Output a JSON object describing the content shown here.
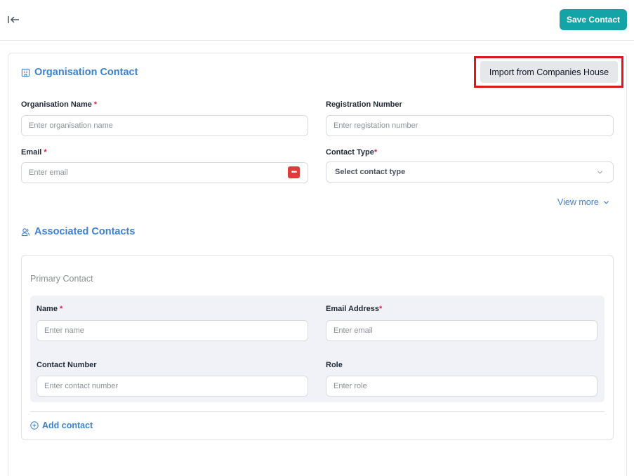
{
  "toolbar": {
    "collapse_icon": "collapse-left-icon",
    "save_label": "Save Contact",
    "accent_color": "#14a3a6"
  },
  "organisation": {
    "title": "Organisation Contact",
    "icon": "building-icon",
    "import_label": "Import from Companies House",
    "fields": {
      "org_name": {
        "label": "Organisation Name",
        "required": "*",
        "placeholder": "Enter organisation name"
      },
      "reg_number": {
        "label": "Registration Number",
        "placeholder": "Enter registation number"
      },
      "email": {
        "label": "Email",
        "required": "*",
        "placeholder": "Enter email",
        "trailing_icon": "password-manager-icon"
      },
      "contact_type": {
        "label": "Contact Type",
        "required": "*",
        "placeholder": "Select contact type"
      }
    },
    "view_more": "View more"
  },
  "associated": {
    "title": "Associated Contacts",
    "icon": "user-group-icon",
    "primary_label": "Primary Contact",
    "fields": {
      "name": {
        "label": "Name",
        "required": "*",
        "placeholder": "Enter name"
      },
      "email": {
        "label": "Email Address",
        "required": "*",
        "placeholder": "Enter email"
      },
      "number": {
        "label": "Contact Number",
        "placeholder": "Enter contact number"
      },
      "role": {
        "label": "Role",
        "placeholder": "Enter role"
      }
    },
    "add_contact": "Add contact"
  },
  "colors": {
    "link": "#3b82d6",
    "required": "#e11d48",
    "highlight": "#e0141b"
  }
}
